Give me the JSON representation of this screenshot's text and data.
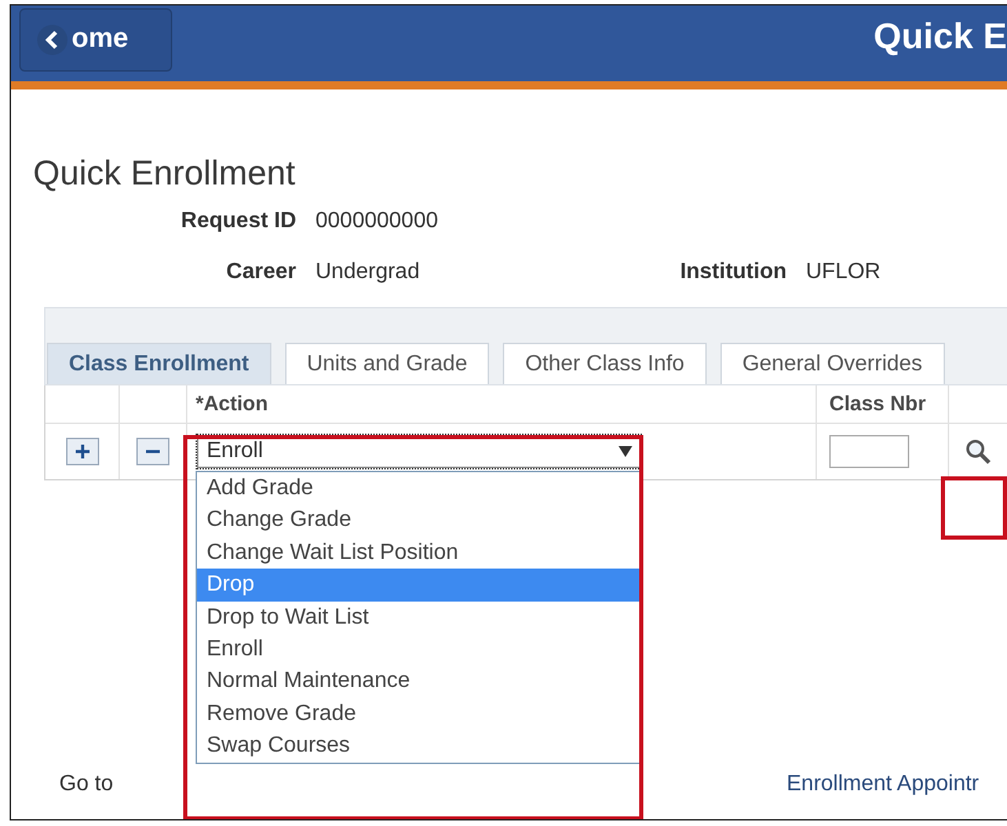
{
  "header": {
    "back_button": "ome",
    "title": "Quick E"
  },
  "page_title": "Quick Enrollment",
  "fields": [
    {
      "label": "Request ID",
      "value": "0000000000"
    },
    {
      "label": "Career",
      "value": "Undergrad"
    },
    {
      "label": "Institution",
      "value": "UFLOR"
    }
  ],
  "tabs": [
    {
      "label": "Class Enrollment",
      "selected": true
    },
    {
      "label": "Units and Grade",
      "selected": false
    },
    {
      "label": "Other Class Info",
      "selected": false
    },
    {
      "label": "General Overrides",
      "selected": false
    }
  ],
  "grid": {
    "columns": [
      "*Action",
      "Class Nbr"
    ],
    "action_value": "Enroll"
  },
  "dropdown": [
    {
      "label": "Add Grade",
      "selected": false
    },
    {
      "label": "Change Grade",
      "selected": false
    },
    {
      "label": "Change Wait List Position",
      "selected": false
    },
    {
      "label": "Drop",
      "selected": true
    },
    {
      "label": "Drop to Wait List",
      "selected": false
    },
    {
      "label": "Enroll",
      "selected": false
    },
    {
      "label": "Normal Maintenance",
      "selected": false
    },
    {
      "label": "Remove Grade",
      "selected": false
    },
    {
      "label": "Swap Courses",
      "selected": false
    }
  ],
  "footer": {
    "go_to": "Go to",
    "link": "Enrollment Appointr"
  }
}
